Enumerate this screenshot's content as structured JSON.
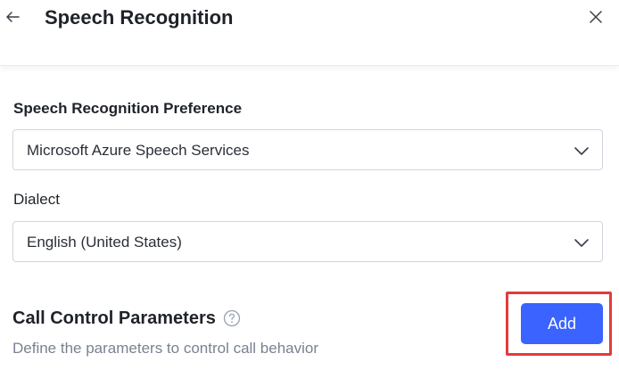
{
  "header": {
    "title": "Speech Recognition",
    "back_icon": "arrow-left-icon",
    "close_icon": "close-icon"
  },
  "preference": {
    "label": "Speech Recognition Preference",
    "selected": "Microsoft Azure Speech Services"
  },
  "dialect": {
    "label": "Dialect",
    "selected": "English (United States)"
  },
  "call_control": {
    "title": "Call Control Parameters",
    "description": "Define the parameters to control call behavior",
    "add_label": "Add",
    "help_icon": "question-circle-icon"
  },
  "colors": {
    "accent": "#3a63ff",
    "highlight": "#e03c3c",
    "muted_text": "#7a8190",
    "border": "#cfd5de"
  }
}
